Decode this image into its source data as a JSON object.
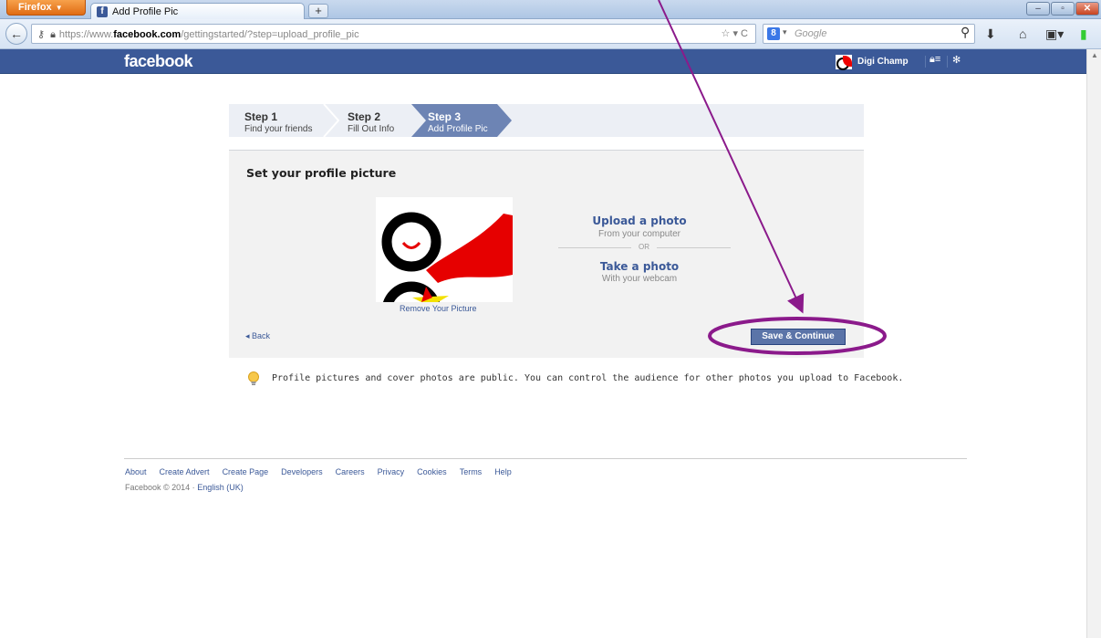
{
  "browser": {
    "menu_button": "Firefox",
    "tab_title": "Add Profile Pic",
    "new_tab": "+",
    "url_prefix": "https://www.",
    "url_domain": "facebook.com",
    "url_path": "/gettingstarted/?step=upload_profile_pic",
    "search_placeholder": "Google"
  },
  "fb": {
    "logo": "facebook",
    "user_name": "Digi Champ"
  },
  "steps": [
    {
      "num": "Step 1",
      "label": "Find your friends"
    },
    {
      "num": "Step 2",
      "label": "Fill Out Info"
    },
    {
      "num": "Step 3",
      "label": "Add Profile Pic"
    }
  ],
  "panel": {
    "title": "Set your profile picture",
    "remove_link": "Remove Your Picture",
    "upload_title": "Upload a photo",
    "upload_sub": "From your computer",
    "or": "OR",
    "take_title": "Take a photo",
    "take_sub": "With your webcam",
    "back": "◂ Back",
    "save": "Save & Continue"
  },
  "tip": "Profile pictures and cover photos are public. You can control the audience for other photos you upload to Facebook.",
  "footer": {
    "links": [
      "About",
      "Create Advert",
      "Create Page",
      "Developers",
      "Careers",
      "Privacy",
      "Cookies",
      "Terms",
      "Help"
    ],
    "copyright": "Facebook © 2014 · ",
    "language": "English (UK)"
  },
  "colors": {
    "fb_blue": "#3b5998",
    "annotation": "#8b1a8b"
  }
}
